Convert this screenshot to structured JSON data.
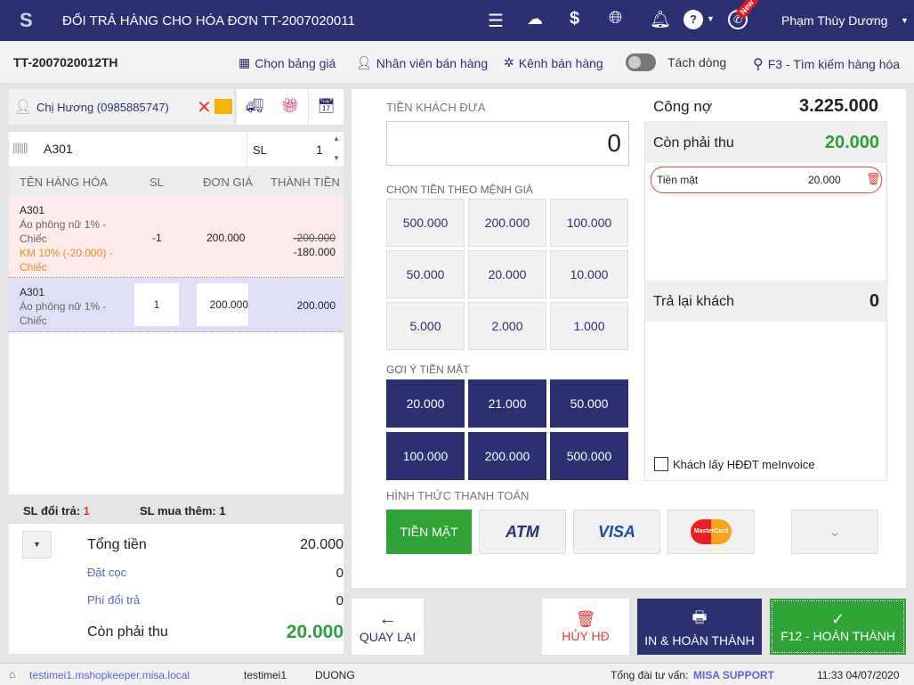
{
  "header": {
    "title": "ĐỔI TRẢ HÀNG CHO HÓA ĐƠN TT-2007020011",
    "user": "Phạm Thùy Dương",
    "new_badge": "New"
  },
  "toolbar": {
    "invoice_code": "TT-2007020012TH",
    "price_list": "Chọn bảng giá",
    "staff": "Nhân viên bán hàng",
    "channel": "Kênh bán hàng",
    "split_line": "Tách dòng",
    "search": "F3 - Tìm kiếm hàng hóa"
  },
  "customer": {
    "name": "Chị Hương (0985885747)"
  },
  "product_search": {
    "value": "A301",
    "qty_label": "SL",
    "qty": "1"
  },
  "table": {
    "headers": [
      "TÊN HÀNG HÓA",
      "SL",
      "ĐƠN GIÁ",
      "THÀNH TIỀN"
    ],
    "rows": [
      {
        "code": "A301",
        "name": "Áo phông nữ 1% - Chiếc",
        "promo": "KM 10% (-20.000) - Chiếc",
        "qty": "-1",
        "price": "200.000",
        "old_total": "-200.000",
        "total": "-180.000"
      },
      {
        "code": "A301",
        "name": "Áo phông nữ 1% - Chiếc",
        "qty": "1",
        "price": "200.000",
        "total": "200.000"
      }
    ]
  },
  "counts": {
    "return_label": "SL đổi trả:",
    "return_value": "1",
    "buy_label": "SL mua thêm:",
    "buy_value": "1"
  },
  "summary": {
    "total_label": "Tổng tiền",
    "total": "20.000",
    "deposit_label": "Đặt cọc",
    "deposit": "0",
    "fee_label": "Phí đổi trả",
    "fee": "0",
    "due_label": "Còn phải thu",
    "due": "20.000"
  },
  "payment": {
    "given_label": "TIỀN KHÁCH ĐƯA",
    "given_value": "0",
    "denom_label": "CHỌN TIỀN THEO MỆNH GIÁ",
    "denoms": [
      "500.000",
      "200.000",
      "100.000",
      "50.000",
      "20.000",
      "10.000",
      "5.000",
      "2.000",
      "1.000"
    ],
    "suggest_label": "GỢI Ý TIỀN MẶT",
    "suggests": [
      "20.000",
      "21.000",
      "50.000",
      "100.000",
      "200.000",
      "500.000"
    ],
    "method_label": "HÌNH THỨC THANH TOÁN",
    "methods": [
      "TIỀN MẶT",
      "ATM",
      "VISA",
      "MasterCard"
    ]
  },
  "right": {
    "debt_label": "Công nợ",
    "debt": "3.225.000",
    "due_label": "Còn phải thu",
    "due": "20.000",
    "cash_label": "Tiền mặt",
    "cash": "20.000",
    "change_label": "Trả lại khách",
    "change": "0",
    "einvoice": "Khách lấy HĐĐT meInvoice"
  },
  "actions": {
    "back": "QUAY LẠI",
    "cancel": "HỦY HĐ",
    "print": "IN & HOÀN THÀNH",
    "finish": "F12 - HOÀN THÀNH"
  },
  "status": {
    "domain": "testimei1.mshopkeeper.misa.local",
    "user": "testimei1",
    "name": "DUONG",
    "hotline_label": "Tổng đài tư vấn:",
    "hotline": "MISA SUPPORT",
    "datetime": "11:33 04/07/2020"
  }
}
